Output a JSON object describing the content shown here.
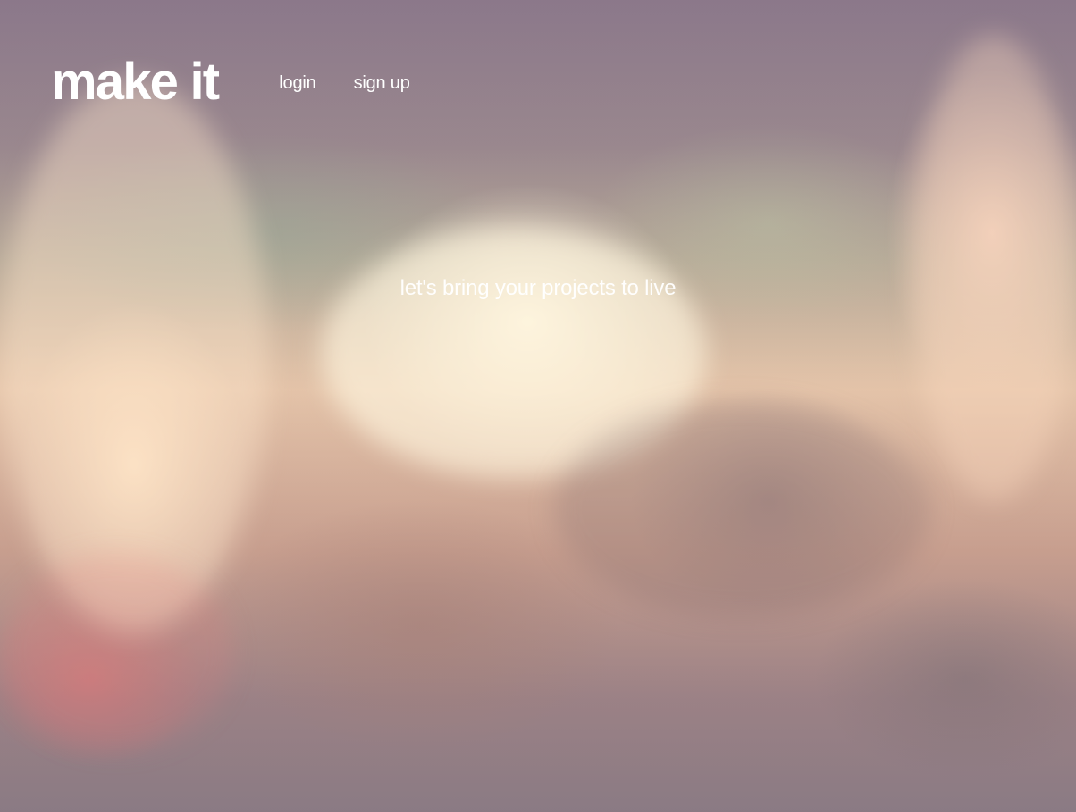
{
  "header": {
    "logo_text": "make it",
    "nav": {
      "login_label": "login",
      "signup_label": "sign up"
    }
  },
  "hero": {
    "tagline": "let's bring your projects to live"
  }
}
